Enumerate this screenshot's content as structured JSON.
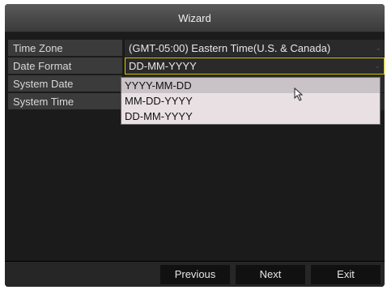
{
  "window": {
    "title": "Wizard"
  },
  "fields": [
    {
      "label": "Time Zone",
      "value": "(GMT-05:00) Eastern Time(U.S. & Canada)"
    },
    {
      "label": "Date Format",
      "value": "DD-MM-YYYY"
    },
    {
      "label": "System Date",
      "value": ""
    },
    {
      "label": "System Time",
      "value": ""
    }
  ],
  "date_format_dropdown": {
    "options": [
      "YYYY-MM-DD",
      "MM-DD-YYYY",
      "DD-MM-YYYY"
    ],
    "hovered": "YYYY-MM-DD"
  },
  "icons": {
    "chevron": "chevron-down-icon",
    "cursor": "mouse-cursor-icon"
  },
  "footer": {
    "previous_label": "Previous",
    "next_label": "Next",
    "exit_label": "Exit"
  },
  "colors": {
    "selected_border": "#d8c800",
    "dropdown_bg": "#e9e0e4"
  }
}
